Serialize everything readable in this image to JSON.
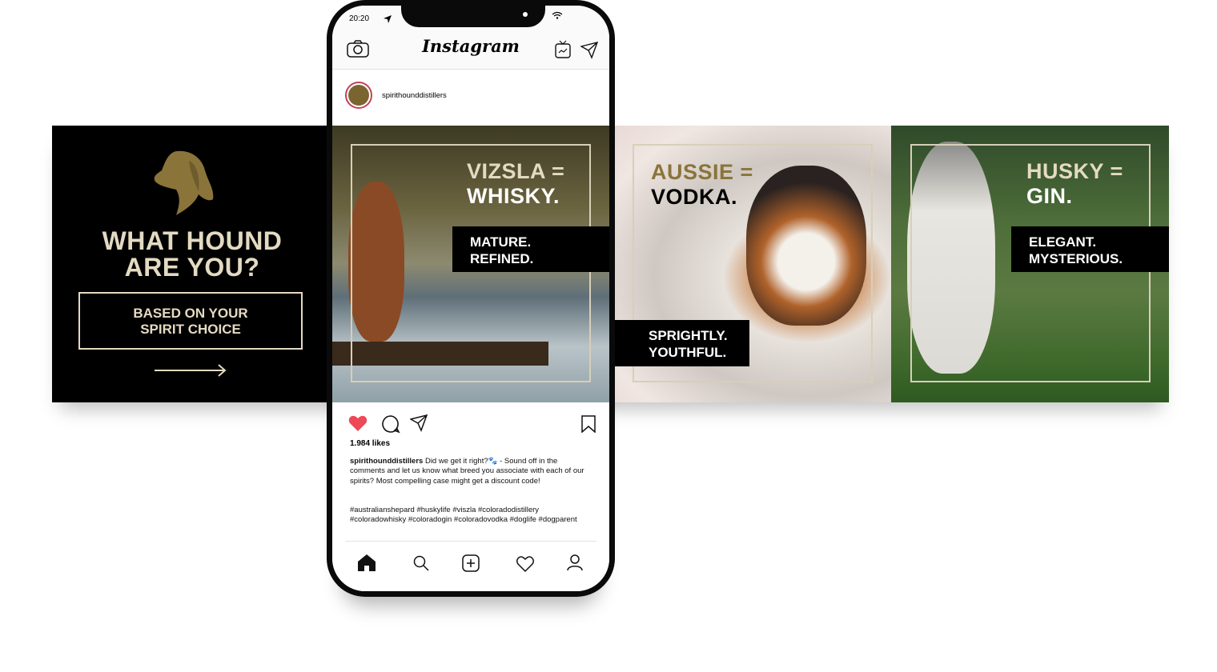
{
  "intro": {
    "title_line1": "WHAT HOUND",
    "title_line2": "ARE YOU?",
    "cta_line1": "BASED ON YOUR",
    "cta_line2": "SPIRIT CHOICE",
    "icon": "dog-head-icon",
    "arrow": "arrow-right-icon"
  },
  "slides": [
    {
      "breed": "VIZSLA =",
      "spirit": "WHISKY.",
      "trait1": "MATURE.",
      "trait2": "REFINED."
    },
    {
      "breed": "AUSSIE =",
      "spirit": "VODKA.",
      "trait1": "SPRIGHTLY.",
      "trait2": "YOUTHFUL."
    },
    {
      "breed": "HUSKY =",
      "spirit": "GIN.",
      "trait1": "ELEGANT.",
      "trait2": "MYSTERIOUS."
    }
  ],
  "colors": {
    "gold": "#8a743a",
    "cream": "#e4dac2",
    "like": "#ed4956"
  },
  "phone": {
    "time": "20:20",
    "app_title": "Instagram",
    "username": "spirithounddistillers",
    "likes": "1.984 likes",
    "caption_user": "spirithounddistillers",
    "caption_text": "Did we get it right?🐾 - Sound off in the comments and let us know what breed you associate with each of our spirits? Most compelling case might get a discount code!",
    "hashtags": "#australianshepard #huskylife #viszla #coloradodistillery #coloradowhisky #coloradogin #coloradovodka #doglife #dogparent",
    "liked": true
  }
}
